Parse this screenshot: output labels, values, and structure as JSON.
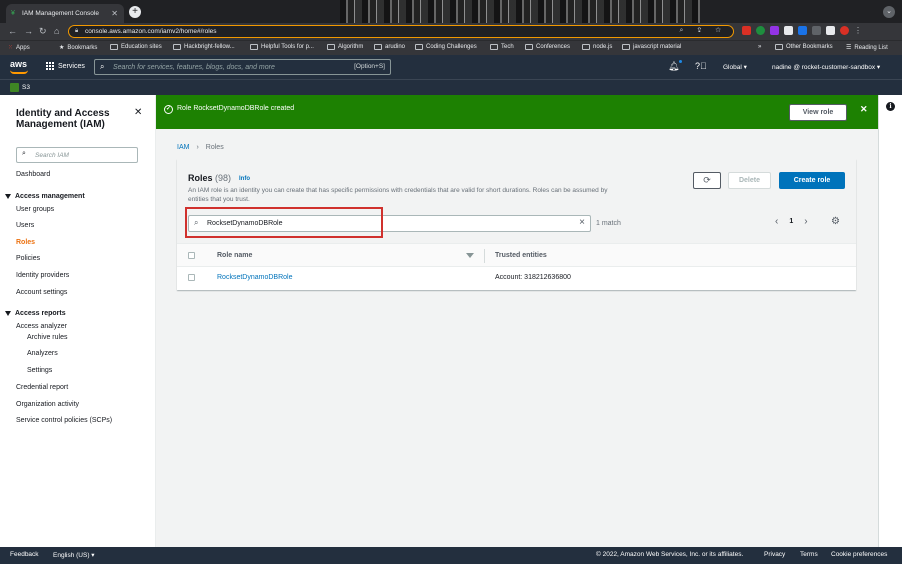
{
  "browser": {
    "tab_title": "IAM Management Console",
    "url": "console.aws.amazon.com/iamv2/home#/roles",
    "bookmarks": [
      "Apps",
      "Bookmarks",
      "Education sites",
      "Hackbright-fellow...",
      "Helpful Tools for p...",
      "Algorithm",
      "arudino",
      "Coding Challenges",
      "Tech",
      "Conferences",
      "node.js",
      "javascript material",
      "Other Bookmarks",
      "Reading List"
    ]
  },
  "aws_header": {
    "logo": "aws",
    "services_label": "Services",
    "search_placeholder": "Search for services, features, blogs, docs, and more",
    "search_shortcut": "[Option+S]",
    "region": "Global ▾",
    "account": "nadine @ rocket-customer-sandbox ▾",
    "favorite": "S3"
  },
  "sidebar": {
    "title": "Identity and Access Management (IAM)",
    "search_placeholder": "Search IAM",
    "dashboard": "Dashboard",
    "access_management": "Access management",
    "items": [
      "User groups",
      "Users",
      "Roles",
      "Policies",
      "Identity providers",
      "Account settings"
    ],
    "access_reports": "Access reports",
    "report_items": [
      "Access analyzer",
      "Archive rules",
      "Analyzers",
      "Settings",
      "Credential report",
      "Organization activity",
      "Service control policies (SCPs)"
    ]
  },
  "flash": {
    "message": "Role RocksetDynamoDBRole created",
    "view_button": "View role"
  },
  "breadcrumb": {
    "root": "IAM",
    "current": "Roles"
  },
  "roles_panel": {
    "title": "Roles",
    "count": "(98)",
    "info": "Info",
    "description": "An IAM role is an identity you can create that has specific permissions with credentials that are valid for short durations. Roles can be assumed by entities that you trust.",
    "delete_label": "Delete",
    "create_label": "Create role",
    "filter_value": "RocksetDynamoDBRole",
    "match_text": "1 match",
    "page": "1",
    "columns": [
      "Role name",
      "Trusted entities"
    ],
    "rows": [
      {
        "role_name": "RocksetDynamoDBRole",
        "trusted": "Account: 318212636800"
      }
    ]
  },
  "footer": {
    "feedback": "Feedback",
    "language": "English (US) ▾",
    "copyright": "© 2022, Amazon Web Services, Inc. or its affiliates.",
    "privacy": "Privacy",
    "terms": "Terms",
    "cookies": "Cookie preferences"
  },
  "colors": {
    "aws_nav": "#232f3e",
    "success": "#1d8102",
    "primary": "#0073bb",
    "active_nav": "#ec7211",
    "highlight_box": "#d0312d"
  }
}
